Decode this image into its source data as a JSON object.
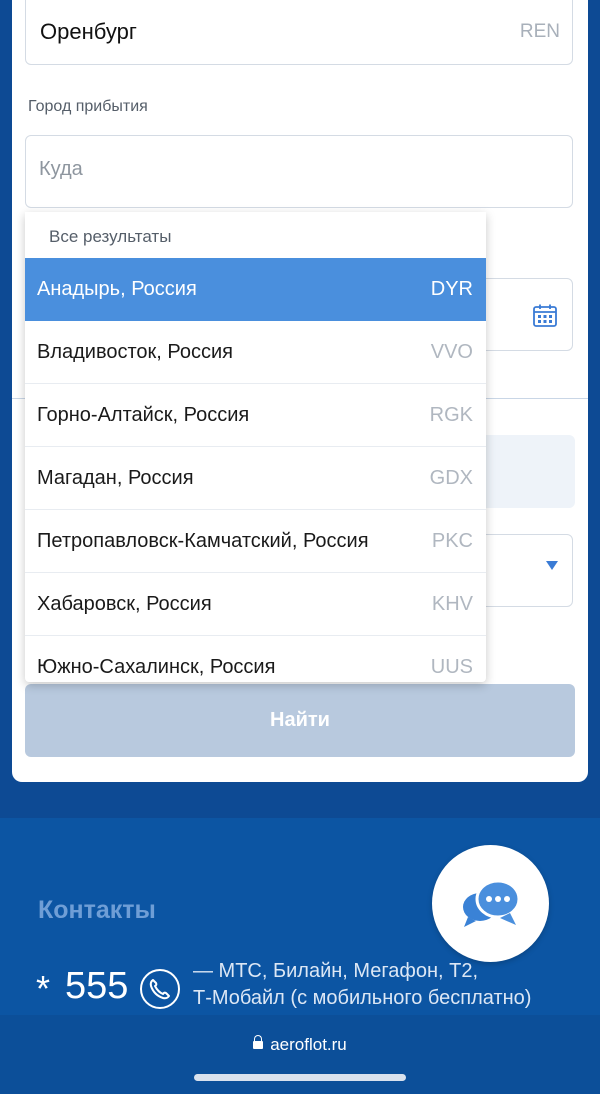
{
  "origin": {
    "city": "Оренбург",
    "code": "REN"
  },
  "arrival": {
    "label": "Город прибытия",
    "placeholder": "Куда"
  },
  "dropdown": {
    "header": "Все результаты",
    "items": [
      {
        "name": "Анадырь, Россия",
        "code": "DYR",
        "active": true
      },
      {
        "name": "Владивосток, Россия",
        "code": "VVO"
      },
      {
        "name": "Горно-Алтайск, Россия",
        "code": "RGK"
      },
      {
        "name": "Магадан, Россия",
        "code": "GDX"
      },
      {
        "name": "Петропавловск-Камчатский, Россия",
        "code": "PKC"
      },
      {
        "name": "Хабаровск, Россия",
        "code": "KHV"
      },
      {
        "name": "Южно-Сахалинск, Россия",
        "code": "UUS"
      }
    ]
  },
  "search_button": "Найти",
  "footer": {
    "contacts_title": "Контакты",
    "phone_star": "*",
    "phone_number": "555",
    "phone_desc_line1": "— МТС, Билайн, Мегафон, T2,",
    "phone_desc_line2": "Т-Мобайл (с мобильного бесплатно)"
  },
  "browser": {
    "url": "aeroflot.ru"
  },
  "icons": {
    "calendar": "calendar-icon",
    "chat": "chat-icon",
    "phone": "phone-icon",
    "lock": "lock-icon"
  },
  "colors": {
    "accent": "#4a8fdd",
    "brand": "#0c55a3",
    "button_disabled": "#b8c9de"
  }
}
